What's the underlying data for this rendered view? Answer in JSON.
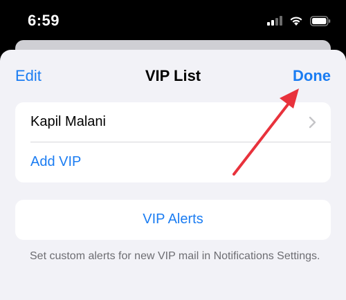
{
  "status_bar": {
    "time": "6:59",
    "icons": [
      "cellular-signal-icon",
      "wifi-icon",
      "battery-icon"
    ]
  },
  "nav": {
    "left_label": "Edit",
    "title": "VIP List",
    "right_label": "Done"
  },
  "vip_list": {
    "items": [
      {
        "label": "Kapil Malani",
        "icon": "chevron-right-icon"
      }
    ],
    "add_label": "Add VIP"
  },
  "alerts": {
    "label": "VIP Alerts",
    "note": "Set custom alerts for new VIP mail in Notifications Settings."
  },
  "colors": {
    "accent": "#1a7cf2",
    "sheet_background": "#f2f2f7",
    "annotation": "#e8323c"
  }
}
